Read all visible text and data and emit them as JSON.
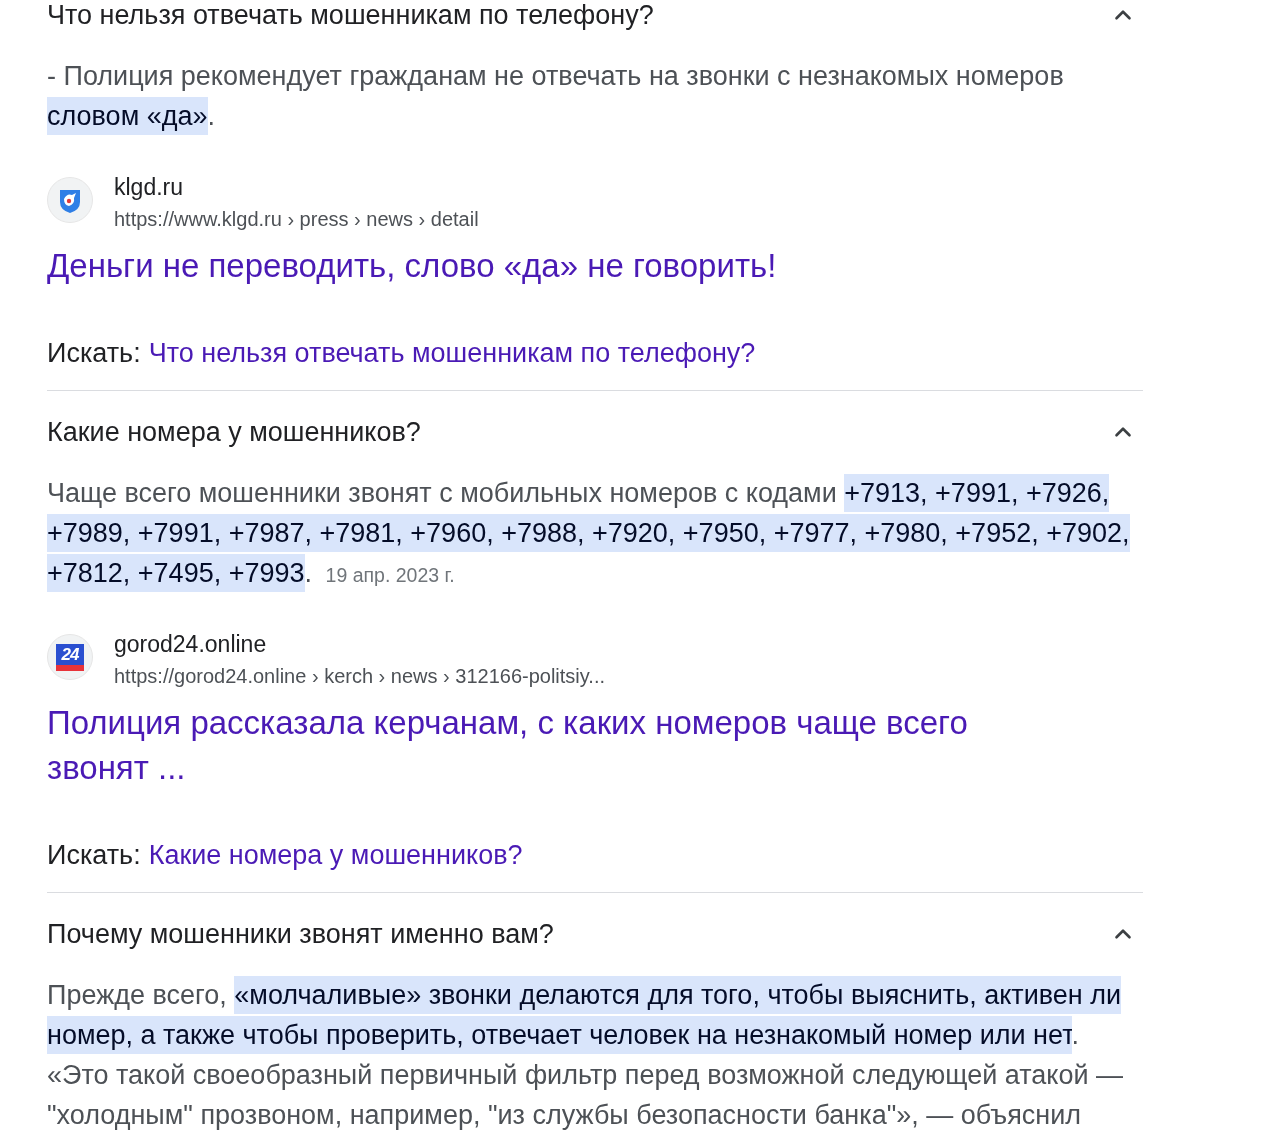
{
  "sections": [
    {
      "question": "Что нельзя отвечать мошенникам по телефону?",
      "expanded": true,
      "answer": [
        {
          "text": "- Полиция рекомендует гражданам не отвечать на звонки с незнакомых номеров ",
          "highlighted": false
        },
        {
          "text": "словом «да»",
          "highlighted": true
        },
        {
          "text": ".",
          "highlighted": false
        }
      ],
      "source": {
        "favicon": {
          "kind": "emblem"
        },
        "site": "klgd.ru",
        "url": "https://www.klgd.ru › press › news › detail",
        "title": "Деньги не переводить, слово «да» не говорить!"
      },
      "search": {
        "label": "Искать:",
        "query": "Что нельзя отвечать мошенникам по телефону?"
      }
    },
    {
      "question": "Какие номера у мошенников?",
      "expanded": true,
      "answer": [
        {
          "text": "Чаще всего мошенники звонят с мобильных номеров с кодами ",
          "highlighted": false
        },
        {
          "text": "+7913, +7991, +7926, +7989, +7991, +7987, +7981, +7960, +7988, +7920, +7950, +7977, +7980, +7952, +7902, +7812, +7495, +7993",
          "highlighted": true
        },
        {
          "text": ".",
          "highlighted": false
        }
      ],
      "date": "19 апр. 2023 г.",
      "source": {
        "favicon": {
          "kind": "badge",
          "text": "24"
        },
        "site": "gorod24.online",
        "url": "https://gorod24.online › kerch › news › 312166-politsiy...",
        "title": "Полиция рассказала керчанам, с каких номеров чаще всего звонят ..."
      },
      "search": {
        "label": "Искать:",
        "query": "Какие номера у мошенников?"
      }
    },
    {
      "question": "Почему мошенники звонят именно вам?",
      "expanded": true,
      "answer": [
        {
          "text": "Прежде всего, ",
          "highlighted": false
        },
        {
          "text": "«молчаливые» звонки делаются для того, чтобы выяснить, активен ли номер, а также чтобы проверить, отвечает человек на незнакомый номер или нет",
          "highlighted": true
        },
        {
          "text": ". «Это такой своеобразный первичный фильтр перед возможной следующей атакой — \"холодным\" прозвоном, например, \"из службы безопасности банка\"», — объяснил",
          "highlighted": false
        }
      ]
    }
  ]
}
